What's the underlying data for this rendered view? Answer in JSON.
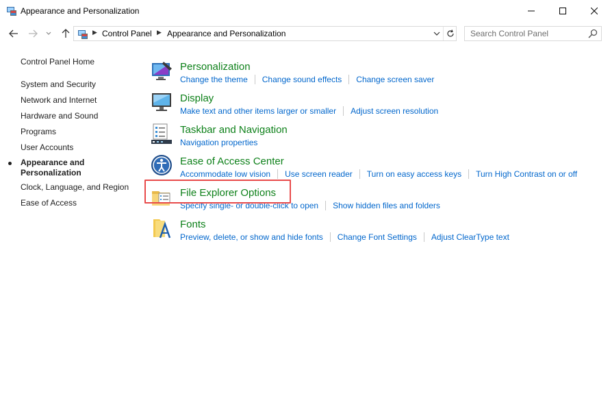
{
  "window": {
    "title": "Appearance and Personalization",
    "controls": {
      "minimize": "minimize-icon",
      "maximize": "maximize-icon",
      "close": "close-icon"
    }
  },
  "navigation": {
    "breadcrumbs": [
      "Control Panel",
      "Appearance and Personalization"
    ],
    "search_placeholder": "Search Control Panel"
  },
  "sidebar": {
    "home": "Control Panel Home",
    "items": [
      "System and Security",
      "Network and Internet",
      "Hardware and Sound",
      "Programs",
      "User Accounts",
      "Appearance and Personalization",
      "Clock, Language, and Region",
      "Ease of Access"
    ],
    "current_index": 5
  },
  "categories": [
    {
      "title": "Personalization",
      "icon": "personalization-icon",
      "links": [
        "Change the theme",
        "Change sound effects",
        "Change screen saver"
      ]
    },
    {
      "title": "Display",
      "icon": "display-icon",
      "links": [
        "Make text and other items larger or smaller",
        "Adjust screen resolution"
      ]
    },
    {
      "title": "Taskbar and Navigation",
      "icon": "taskbar-icon",
      "links": [
        "Navigation properties"
      ]
    },
    {
      "title": "Ease of Access Center",
      "icon": "ease-of-access-icon",
      "links": [
        "Accommodate low vision",
        "Use screen reader",
        "Turn on easy access keys",
        "Turn High Contrast on or off"
      ]
    },
    {
      "title": "File Explorer Options",
      "icon": "file-explorer-options-icon",
      "links": [
        "Specify single- or double-click to open",
        "Show hidden files and folders"
      ]
    },
    {
      "title": "Fonts",
      "icon": "fonts-icon",
      "links": [
        "Preview, delete, or show and hide fonts",
        "Change Font Settings",
        "Adjust ClearType text"
      ]
    }
  ],
  "colors": {
    "category_title": "#0d8019",
    "link": "#0066cc",
    "highlight_border": "#e84a4a"
  }
}
